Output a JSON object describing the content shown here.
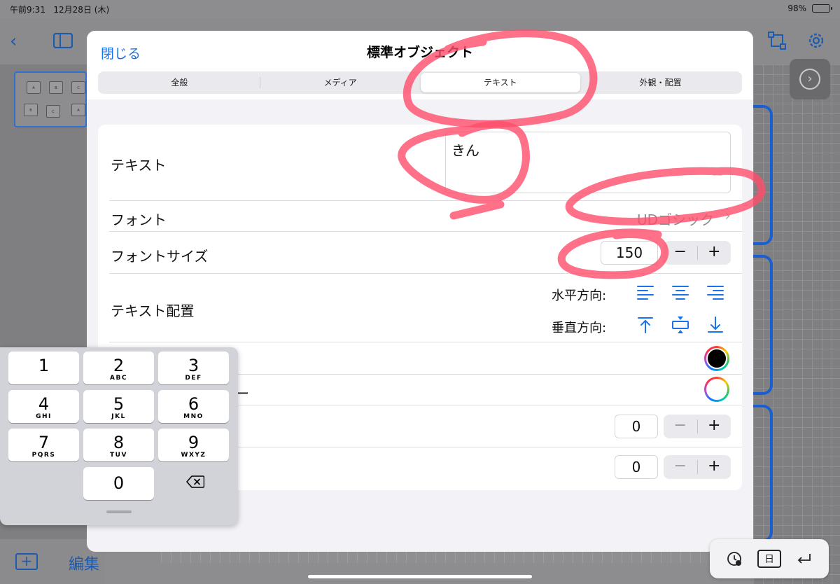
{
  "status_bar": {
    "time": "午前9:31",
    "date": "12月28日 (木)",
    "battery": "98%",
    "battery_level": 0.98
  },
  "background": {
    "thumbnail_keys": [
      "A",
      "B",
      "C",
      "B",
      "C",
      "A"
    ],
    "edit_label": "編集"
  },
  "modal": {
    "close_label": "閉じる",
    "title": "標準オブジェクト",
    "tabs": [
      {
        "label": "全般"
      },
      {
        "label": "メディア"
      },
      {
        "label": "テキスト"
      },
      {
        "label": "外観・配置"
      }
    ],
    "active_tab": "テキスト",
    "rows": {
      "text_label": "テキスト",
      "text_value": "きん",
      "font_label": "フォント",
      "font_value": "UDゴシック",
      "font_size_label": "フォントサイズ",
      "font_size_value": "150",
      "alignment_label": "テキスト配置",
      "horizontal_label": "水平方向:",
      "vertical_label": "垂直方向:",
      "partial_label_fragment": "ー",
      "value_row_1": "0",
      "value_row_2": "0"
    },
    "text_color": "#000000",
    "stepper_minus": "−",
    "stepper_plus": "+"
  },
  "keypad": {
    "keys": [
      {
        "num": "1",
        "letters": ""
      },
      {
        "num": "2",
        "letters": "ABC"
      },
      {
        "num": "3",
        "letters": "DEF"
      },
      {
        "num": "4",
        "letters": "GHI"
      },
      {
        "num": "5",
        "letters": "JKL"
      },
      {
        "num": "6",
        "letters": "MNO"
      },
      {
        "num": "7",
        "letters": "PQRS"
      },
      {
        "num": "8",
        "letters": "TUV"
      },
      {
        "num": "9",
        "letters": "WXYZ"
      },
      {
        "num": "0",
        "letters": ""
      }
    ]
  },
  "colors": {
    "accent": "#1a73e8",
    "scribble": "#ff4d6a"
  }
}
